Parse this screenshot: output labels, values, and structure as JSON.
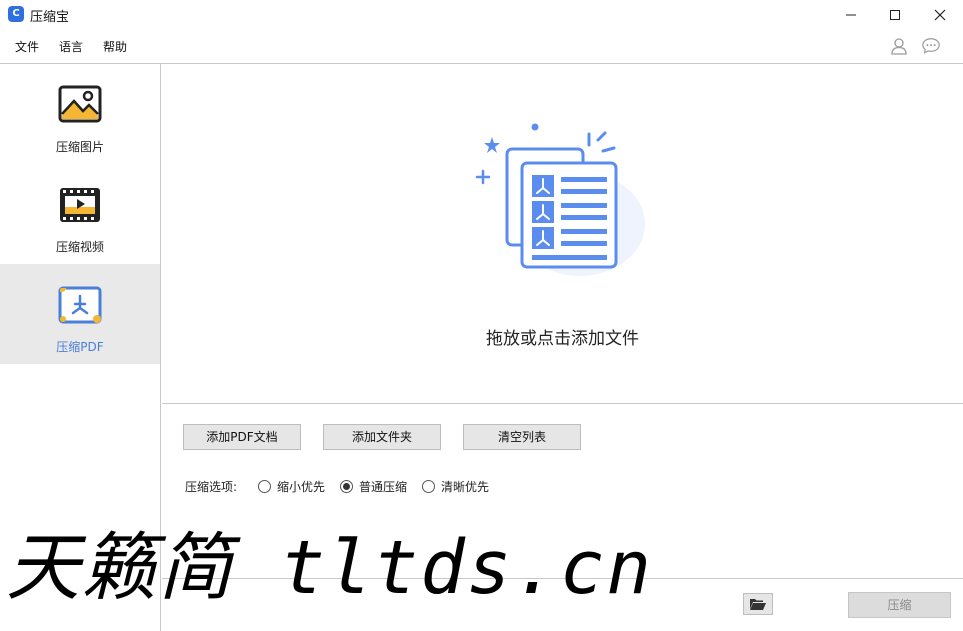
{
  "window": {
    "title": "压缩宝",
    "app_icon_glyph": "C"
  },
  "menu": [
    "文件",
    "语言",
    "帮助"
  ],
  "sidebar": {
    "items": [
      {
        "label": "压缩图片",
        "icon": "image-icon",
        "active": false
      },
      {
        "label": "压缩视频",
        "icon": "video-icon",
        "active": false
      },
      {
        "label": "压缩PDF",
        "icon": "pdf-icon",
        "active": true
      }
    ]
  },
  "dropzone": {
    "text": "拖放或点击添加文件",
    "icon": "pdf-document-illustration"
  },
  "actions": [
    "添加PDF文档",
    "添加文件夹",
    "清空列表"
  ],
  "options": {
    "label": "压缩选项:",
    "choices": [
      "缩小优先",
      "普通压缩",
      "清晰优先"
    ],
    "selected": "普通压缩"
  },
  "footer": {
    "folder_icon": "folder-open-icon",
    "compress_label": "压缩"
  },
  "watermark": "天籁简 tltds.cn",
  "colors": {
    "accent": "#4a7fd8",
    "illustration": "#5b8def",
    "sidebar_active_bg": "#e9e9e9"
  }
}
